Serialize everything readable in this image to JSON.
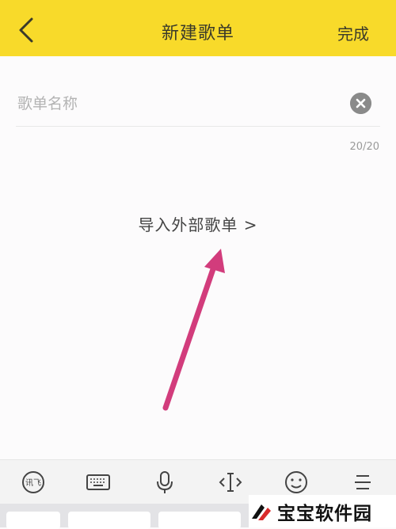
{
  "header": {
    "title": "新建歌单",
    "done_label": "完成",
    "back_icon": "chevron-left-icon",
    "bg_color": "#f8da2a"
  },
  "form": {
    "name_placeholder": "歌单名称",
    "name_value": "",
    "counter": "20/20",
    "clear_icon": "clear-circle-icon"
  },
  "import_link": {
    "label": "导入外部歌单 >"
  },
  "annotation": {
    "arrow_color": "#d23c7c"
  },
  "keyboard_toolbar": {
    "items": [
      "ifly-logo-icon",
      "keyboard-icon",
      "microphone-icon",
      "cursor-move-icon",
      "emoji-icon",
      "menu-icon"
    ]
  },
  "watermark": {
    "text": "宝宝软件园"
  }
}
